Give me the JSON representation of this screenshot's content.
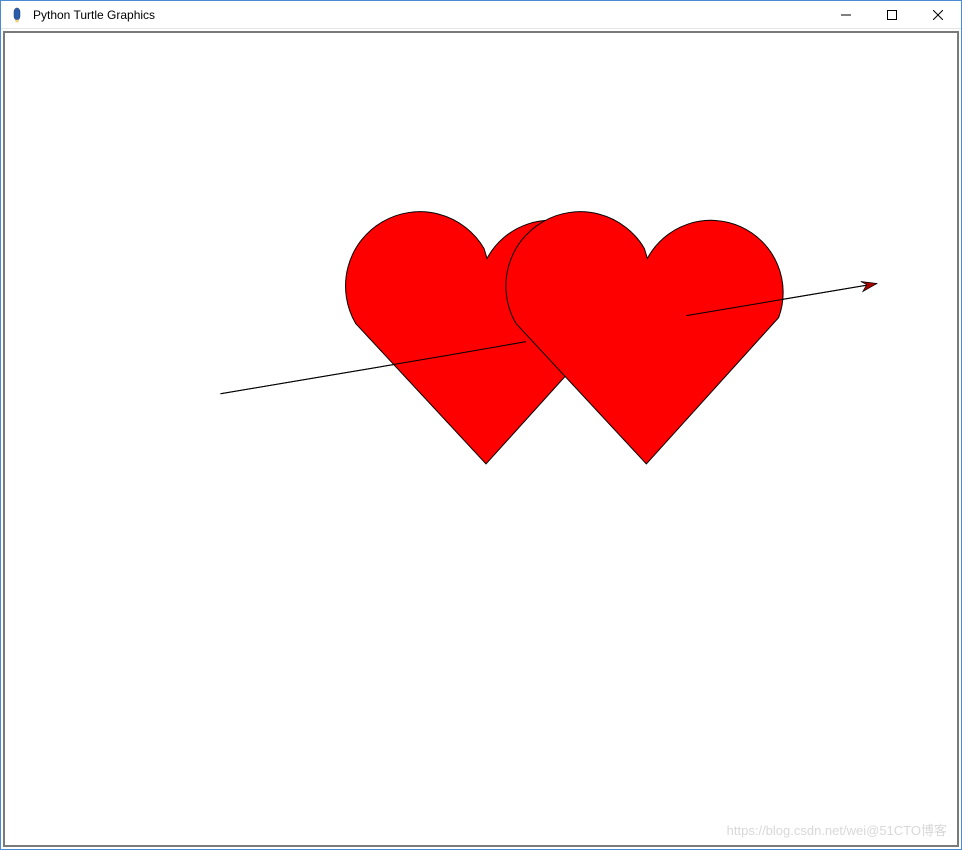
{
  "window": {
    "title": "Python Turtle Graphics",
    "icon_name": "turtle-app-icon"
  },
  "controls": {
    "minimize": "—",
    "maximize": "☐",
    "close": "✕"
  },
  "canvas": {
    "hearts": {
      "color": "#ff0000",
      "stroke": "#000000",
      "count": 2
    },
    "arrow": {
      "stroke": "#000000",
      "head_fill": "#cc0000"
    }
  },
  "watermark": "https://blog.csdn.net/wei@51CTO博客"
}
